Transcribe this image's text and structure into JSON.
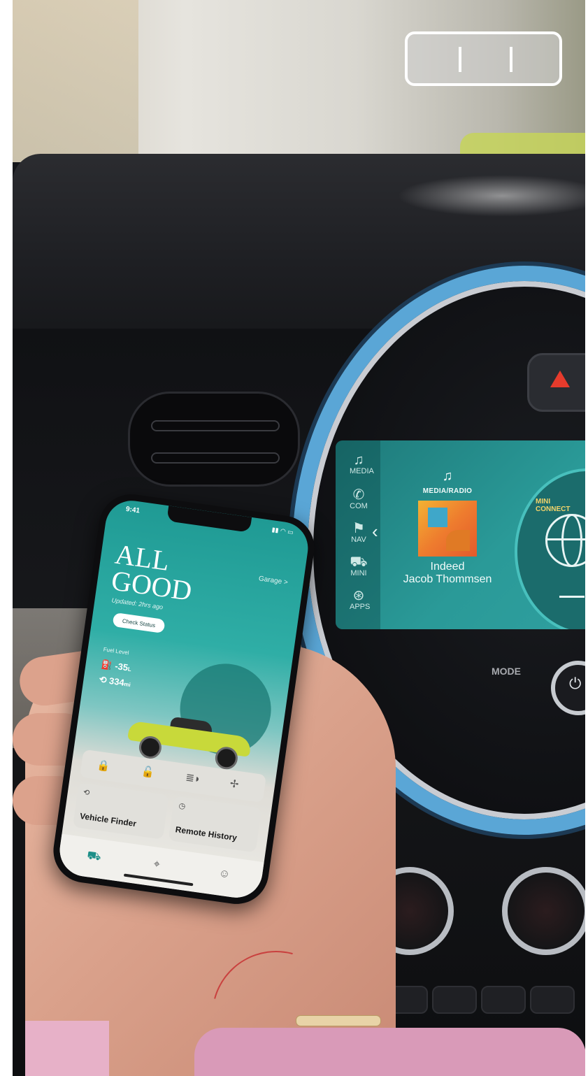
{
  "pause_control": {
    "icon": "pause-icon"
  },
  "infotainment": {
    "side_menu": [
      {
        "icon": "music-icon",
        "label": "MEDIA"
      },
      {
        "icon": "phone-icon",
        "label": "COM"
      },
      {
        "icon": "flag-icon",
        "label": "NAV"
      },
      {
        "icon": "car-icon",
        "label": "MINI"
      },
      {
        "icon": "apps-icon",
        "label": "APPS"
      }
    ],
    "media_title": "MEDIA/RADIO",
    "song": "Indeed",
    "artist": "Jacob Thommsen",
    "connect_label": "MINI CONNECT",
    "mode_label": "MODE",
    "accent": "#48c0bd",
    "warning_color": "#e63b2c"
  },
  "phone_app": {
    "time": "9:41",
    "garage_link": "Garage >",
    "headline": "ALL\nGOOD",
    "updated": "Updated: 2hrs ago",
    "check_status": "Check Status",
    "fuel_label": "Fuel Level",
    "fuel_value": "-35",
    "fuel_unit": "L",
    "range_value": "334",
    "range_unit": "mi",
    "quick_actions": [
      "lock-icon",
      "unlock-icon",
      "headlight-icon",
      "fan-icon"
    ],
    "vehicle_finder": "Vehicle Finder",
    "remote_history": "Remote History",
    "tabs": [
      "car-tab-icon",
      "location-tab-icon",
      "profile-tab-icon"
    ],
    "accent": "#1d8f88",
    "car_color": "#c8d93a"
  }
}
